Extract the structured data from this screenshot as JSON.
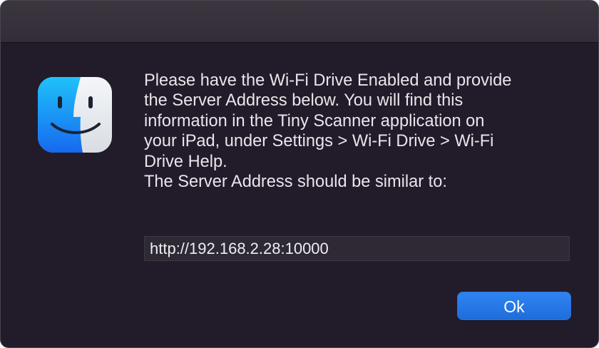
{
  "dialog": {
    "message_lines": [
      "Please have the Wi-Fi Drive Enabled and provide",
      "the Server Address below. You will find this",
      "information in the Tiny Scanner application on",
      "your iPad, under Settings > Wi-Fi Drive > Wi-Fi",
      "Drive Help."
    ],
    "hint_line": "The Server Address should be similar to:",
    "address_value": "http://192.168.2.28:10000",
    "ok_label": "Ok"
  },
  "icons": {
    "app_icon": "finder-icon"
  },
  "colors": {
    "background": "#221b2a",
    "titlebar": "#37323c",
    "text": "#e8e6ea",
    "field_background": "#2e2935",
    "accent": "#2577e6"
  }
}
